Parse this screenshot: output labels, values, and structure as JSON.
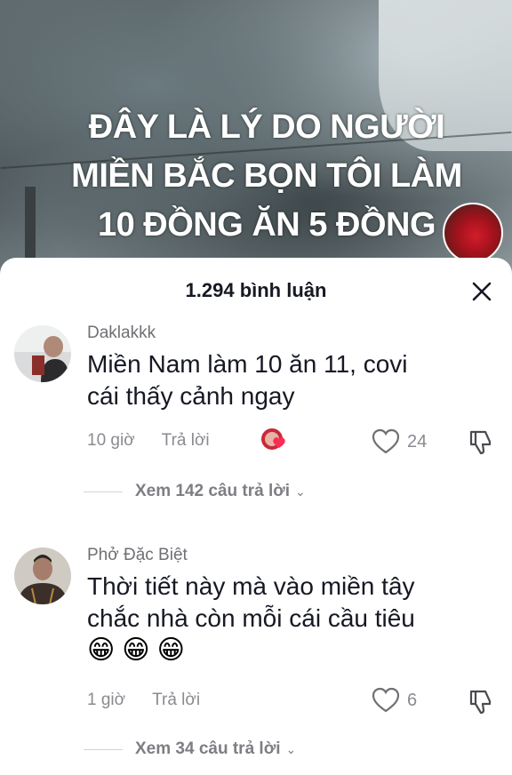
{
  "video": {
    "caption_lines": [
      "ĐÂY LÀ LÝ DO NGƯỜI",
      "MIỀN BẮC BỌN TÔI LÀM",
      "10 ĐỒNG ĂN 5 ĐỒNG"
    ]
  },
  "sheet": {
    "title": "1.294 bình luận",
    "close_icon": "close-icon"
  },
  "comments": [
    {
      "username": "Daklakkk",
      "text_lines": [
        "Miền Nam làm 10 ăn 11, covi",
        "cái thấy cảnh ngay"
      ],
      "time": "10 giờ",
      "reply_label": "Trả lời",
      "likes": "24",
      "replies_label": "Xem 142 câu trả lời"
    },
    {
      "username": "Phở Đặc Biệt",
      "text_lines": [
        "Thời tiết này mà vào miền tây",
        "chắc nhà còn mỗi cái cầu tiêu"
      ],
      "emojis": [
        "😁",
        "😁",
        "😁"
      ],
      "time": "1 giờ",
      "reply_label": "Trả lời",
      "likes": "6",
      "replies_label": "Xem 34 câu trả lời"
    }
  ],
  "colors": {
    "text_primary": "#161823",
    "text_secondary": "#8a8b91",
    "sheet_bg": "#ffffff"
  }
}
